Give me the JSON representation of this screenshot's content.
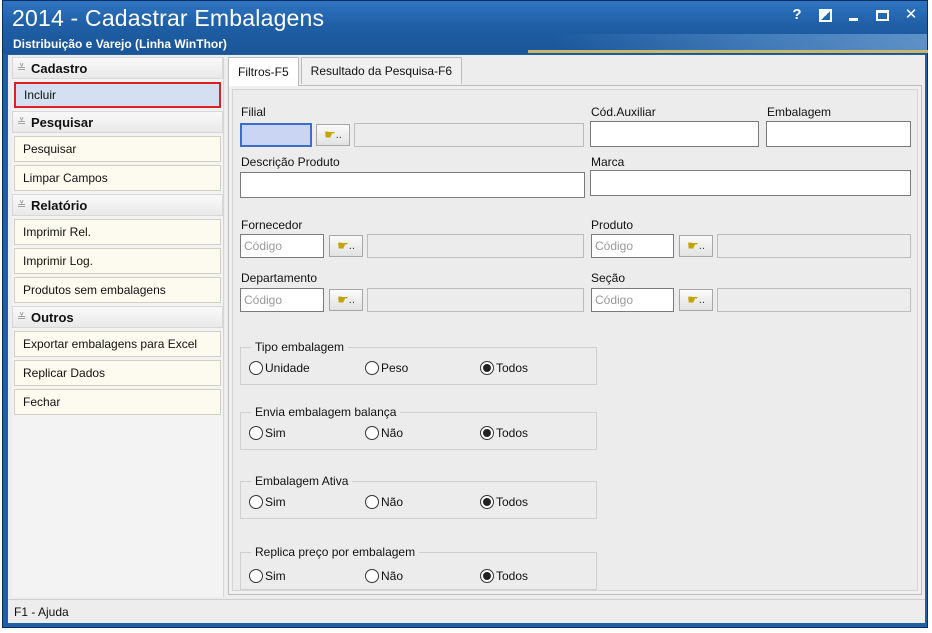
{
  "window": {
    "title": "2014 - Cadastrar Embalagens",
    "subtitle": "Distribuição e Varejo (Linha WinThor)",
    "buttons": {
      "help": "?",
      "contrast": "",
      "minimize": "",
      "maximize": "",
      "close": "✕"
    }
  },
  "sidebar": {
    "groups": [
      {
        "title": "Cadastro",
        "items": [
          "Incluir"
        ]
      },
      {
        "title": "Pesquisar",
        "items": [
          "Pesquisar",
          "Limpar Campos"
        ]
      },
      {
        "title": "Relatório",
        "items": [
          "Imprimir Rel.",
          "Imprimir Log.",
          "Produtos sem embalagens"
        ]
      },
      {
        "title": "Outros",
        "items": [
          "Exportar embalagens para Excel",
          "Replicar Dados",
          "Fechar"
        ]
      }
    ],
    "selected_item": "Incluir"
  },
  "tabs": [
    "Filtros-F5",
    "Resultado da Pesquisa-F6"
  ],
  "active_tab": "Filtros-F5",
  "form": {
    "filial_label": "Filial",
    "cod_auxiliar_label": "Cód.Auxiliar",
    "embalagem_label": "Embalagem",
    "descricao_label": "Descrição Produto",
    "marca_label": "Marca",
    "fornecedor_label": "Fornecedor",
    "produto_label": "Produto",
    "departamento_label": "Departamento",
    "secao_label": "Seção",
    "codigo_placeholder": "Código",
    "lookup_label": ".."
  },
  "radio_groups": [
    {
      "title": "Tipo embalagem",
      "options": [
        "Unidade",
        "Peso",
        "Todos"
      ],
      "selected": "Todos"
    },
    {
      "title": "Envia embalagem balança",
      "options": [
        "Sim",
        "Não",
        "Todos"
      ],
      "selected": "Todos"
    },
    {
      "title": "Embalagem Ativa",
      "options": [
        "Sim",
        "Não",
        "Todos"
      ],
      "selected": "Todos"
    },
    {
      "title": "Replica preço por embalagem",
      "options": [
        "Sim",
        "Não",
        "Todos"
      ],
      "selected": "Todos"
    }
  ],
  "status_bar": "F1 - Ajuda",
  "colors": {
    "title_bar": "#1f5fa6",
    "selected_highlight": "#e02020"
  }
}
